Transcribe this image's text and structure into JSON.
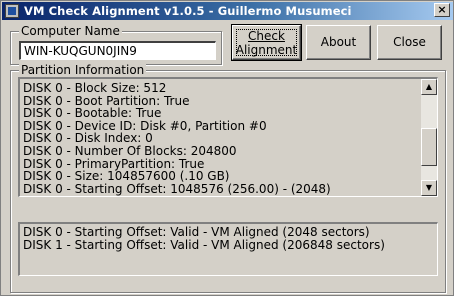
{
  "window": {
    "title": "VM Check Alignment v1.0.5 - Guillermo Musumeci",
    "close_glyph": "×"
  },
  "computer": {
    "group_label": "Computer Name",
    "value": "WIN-KUQGUN0JIN9"
  },
  "buttons": {
    "check_line1": "Check",
    "check_line2": "Alignment",
    "about": "About",
    "close": "Close"
  },
  "partition": {
    "group_label": "Partition Information",
    "details": [
      "DISK 0 - Block Size: 512",
      "DISK 0 - Boot Partition: True",
      "DISK 0 - Bootable: True",
      "DISK 0 - Device ID: Disk #0, Partition #0",
      "DISK 0 - Disk Index: 0",
      "DISK 0 - Number Of Blocks: 204800",
      "DISK 0 - PrimaryPartition: True",
      "DISK 0 - Size: 104857600 (.10 GB)",
      "DISK 0 - Starting Offset: 1048576 (256.00) - (2048)"
    ],
    "scroll": {
      "up_glyph": "▲",
      "down_glyph": "▼",
      "position": 0.7,
      "visible_fraction": 0.45
    },
    "results": [
      "DISK 0 - Starting Offset: Valid  - VM Aligned (2048 sectors)",
      "DISK 1 - Starting Offset: Valid  - VM Aligned (206848 sectors)"
    ]
  }
}
